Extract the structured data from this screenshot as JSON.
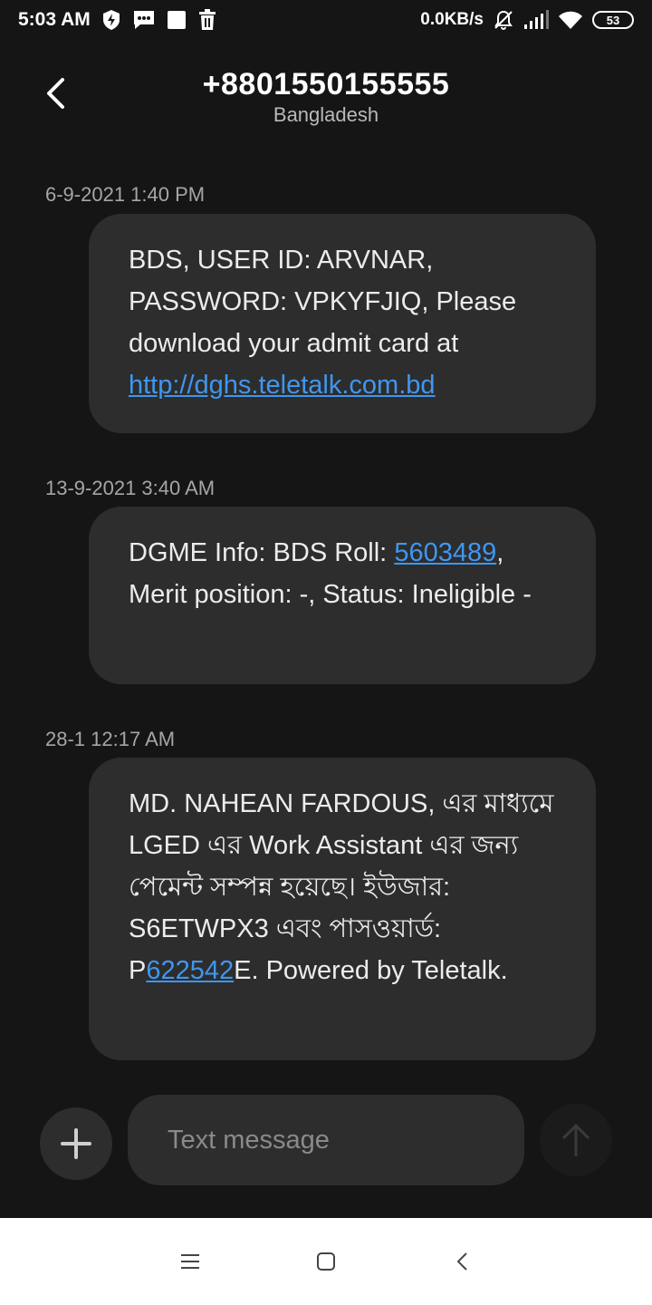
{
  "status_bar": {
    "time": "5:03 AM",
    "network_speed": "0.0KB/s",
    "battery": "53",
    "icons": [
      "shield-bolt-icon",
      "message-icon",
      "square-icon",
      "trash-icon",
      "mute-bell-icon",
      "signal-icon",
      "wifi-icon",
      "battery-icon"
    ]
  },
  "header": {
    "title": "+8801550155555",
    "subtitle": "Bangladesh"
  },
  "messages": [
    {
      "timestamp": "6-9-2021 1:40 PM",
      "text_before": "BDS, USER ID: ARVNAR, PASSWORD: VPKYFJIQ, Please download your admit card at ",
      "link": "http://dghs.teletalk.com.bd",
      "text_after": ""
    },
    {
      "timestamp": "13-9-2021 3:40 AM",
      "text_before": "DGME Info: BDS Roll: ",
      "link": "5603489",
      "text_after": ", Merit position: -, Status: Ineligible -"
    },
    {
      "timestamp": "28-1 12:17 AM",
      "text_before": "MD. NAHEAN FARDOUS,  এর মাধ্যমে LGED এর Work Assistant এর জন্য পেমেন্ট সম্পন্ন হয়েছে। ইউজার: S6ETWPX3 এবং পাসওয়ার্ড: P",
      "link": "622542",
      "text_after": "E. Powered by Teletalk."
    }
  ],
  "composer": {
    "placeholder": "Text message"
  },
  "colors": {
    "background": "#151515",
    "bubble": "#2d2d2d",
    "link": "#3f97f0",
    "nav_bar": "#ffffff"
  }
}
